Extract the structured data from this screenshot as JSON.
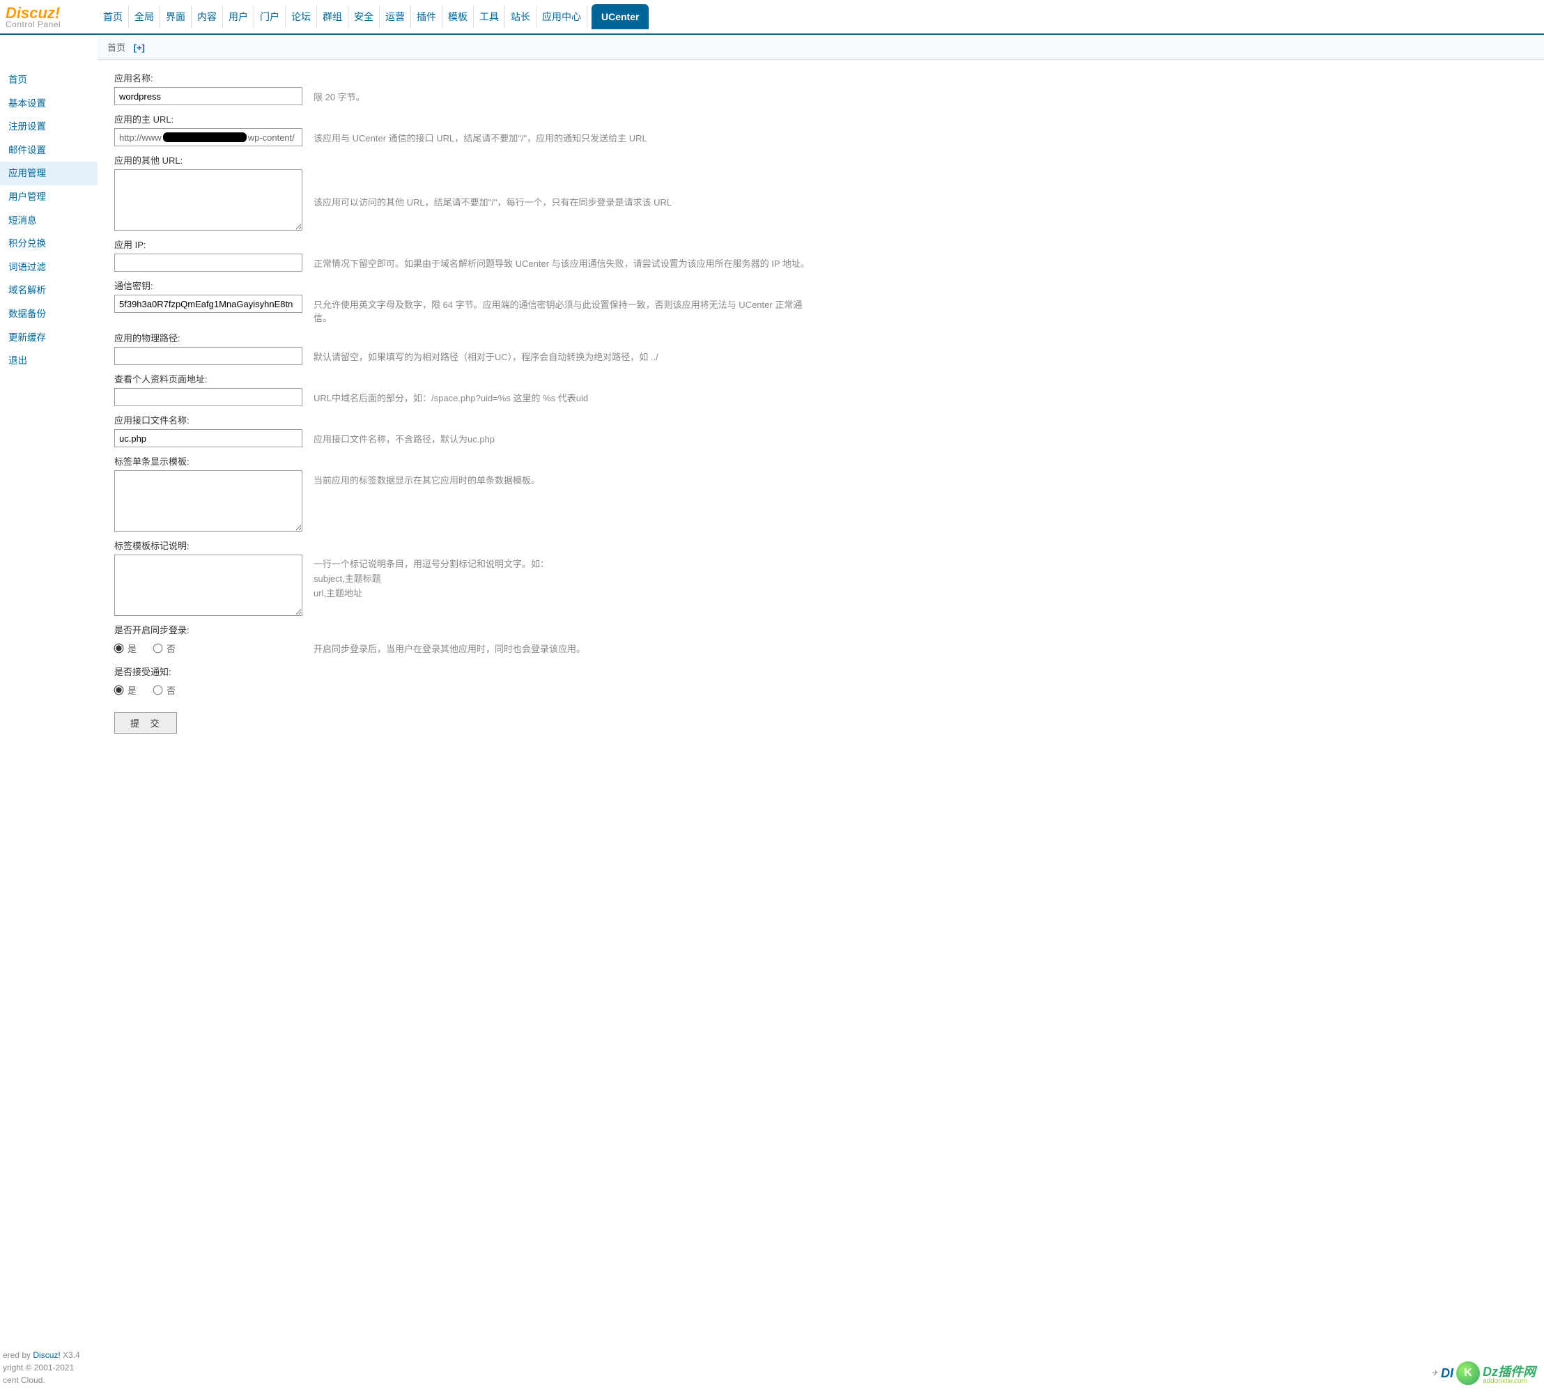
{
  "logo": {
    "line1": "Discuz",
    "excl": "!",
    "line2": "Control Panel"
  },
  "topnav": [
    {
      "label": "首页"
    },
    {
      "label": "全局"
    },
    {
      "label": "界面"
    },
    {
      "label": "内容"
    },
    {
      "label": "用户"
    },
    {
      "label": "门户"
    },
    {
      "label": "论坛"
    },
    {
      "label": "群组"
    },
    {
      "label": "安全"
    },
    {
      "label": "运营"
    },
    {
      "label": "插件"
    },
    {
      "label": "模板"
    },
    {
      "label": "工具"
    },
    {
      "label": "站长"
    },
    {
      "label": "应用中心"
    },
    {
      "label": "UCenter",
      "active": true
    }
  ],
  "breadcrumb": {
    "home": "首页",
    "plus": "[+]"
  },
  "sidebar": [
    {
      "label": "首页"
    },
    {
      "label": "基本设置"
    },
    {
      "label": "注册设置"
    },
    {
      "label": "邮件设置"
    },
    {
      "label": "应用管理",
      "active": true
    },
    {
      "label": "用户管理"
    },
    {
      "label": "短消息"
    },
    {
      "label": "积分兑换"
    },
    {
      "label": "词语过滤"
    },
    {
      "label": "域名解析"
    },
    {
      "label": "数据备份"
    },
    {
      "label": "更新缓存"
    },
    {
      "label": "退出"
    }
  ],
  "form": {
    "app_name": {
      "label": "应用名称:",
      "value": "wordpress",
      "help": "限 20 字节。"
    },
    "main_url": {
      "label": "应用的主 URL:",
      "value_prefix": "http://www",
      "value_suffix": "wp-content/",
      "help": "该应用与 UCenter 通信的接口 URL，结尾请不要加\"/\"，应用的通知只发送给主 URL"
    },
    "extra_urls": {
      "label": "应用的其他 URL:",
      "value": "",
      "help": "该应用可以访问的其他 URL，结尾请不要加\"/\"，每行一个，只有在同步登录是请求该 URL"
    },
    "app_ip": {
      "label": "应用 IP:",
      "value": "",
      "help": "正常情况下留空即可。如果由于域名解析问题导致 UCenter 与该应用通信失败，请尝试设置为该应用所在服务器的 IP 地址。"
    },
    "comm_key": {
      "label": "通信密钥:",
      "value": "5f39h3a0R7fzpQmEafg1MnaGayisyhnE8tn",
      "help": "只允许使用英文字母及数字，限 64 字节。应用端的通信密钥必须与此设置保持一致，否则该应用将无法与 UCenter 正常通信。"
    },
    "phys_path": {
      "label": "应用的物理路径:",
      "value": "",
      "help": "默认请留空，如果填写的为相对路径（相对于UC），程序会自动转换为绝对路径，如 ../"
    },
    "profile_url": {
      "label": "查看个人资料页面地址:",
      "value": "",
      "help": "URL中域名后面的部分，如：/space.php?uid=%s 这里的 %s 代表uid"
    },
    "api_file": {
      "label": "应用接口文件名称:",
      "value": "uc.php",
      "help": "应用接口文件名称，不含路径，默认为uc.php"
    },
    "tag_template": {
      "label": "标签单条显示模板:",
      "value": "",
      "help": "当前应用的标签数据显示在其它应用时的单条数据模板。"
    },
    "tag_help": {
      "label": "标签模板标记说明:",
      "value": "",
      "help_line1": "一行一个标记说明条目，用逗号分割标记和说明文字。如：",
      "help_line2": "subject,主题标题",
      "help_line3": "url,主题地址"
    },
    "sync_login": {
      "label": "是否开启同步登录:",
      "yes": "是",
      "no": "否",
      "help": "开启同步登录后，当用户在登录其他应用时，同时也会登录该应用。"
    },
    "accept_notify": {
      "label": "是否接受通知:",
      "yes": "是",
      "no": "否"
    },
    "submit": "提 交"
  },
  "footer": {
    "line1_pre": "ered by ",
    "line1_link": "Discuz!",
    "line1_post": " X3.4",
    "line2": "yright © 2001-2021",
    "line3": "cent Cloud.",
    "right_text1": "DI",
    "right_text2": "Dz插件网",
    "right_sub": "addonxtw.com"
  }
}
